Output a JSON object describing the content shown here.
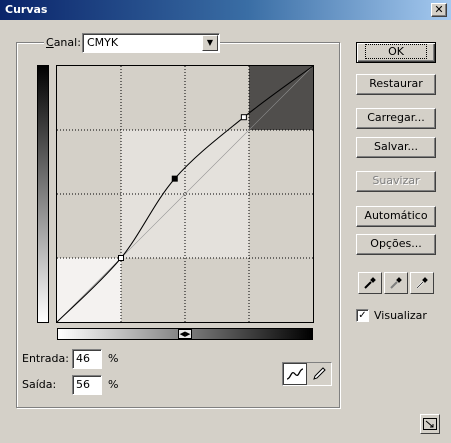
{
  "window": {
    "title": "Curvas",
    "close_label": "✕"
  },
  "channel": {
    "label": "Canal:",
    "value": "CMYK"
  },
  "curve": {
    "points": [
      [
        0,
        0
      ],
      [
        25,
        25
      ],
      [
        46,
        56
      ],
      [
        73,
        80
      ],
      [
        100,
        100
      ]
    ],
    "zone_colors": {
      "highlight": "#f4f2f0",
      "midtone": "#e4e1dc",
      "shadow": "#504e4c",
      "base": "#d4d0c8"
    }
  },
  "input": {
    "label": "Entrada:",
    "value": "46",
    "unit": "%"
  },
  "output": {
    "label": "Saída:",
    "value": "56",
    "unit": "%"
  },
  "buttons": {
    "ok": "OK",
    "reset": "Restaurar",
    "load": "Carregar...",
    "save": "Salvar...",
    "smooth": "Suavizar",
    "auto": "Automático",
    "options": "Opções..."
  },
  "preview": {
    "label": "Visualizar",
    "checked": true
  },
  "tools": {
    "active": "curve-tool"
  },
  "icons": [
    "curve-tool-icon",
    "pencil-tool-icon",
    "black-eyedropper-icon",
    "gray-eyedropper-icon",
    "white-eyedropper-icon",
    "expand-icon",
    "gradient-toggle-icon"
  ]
}
